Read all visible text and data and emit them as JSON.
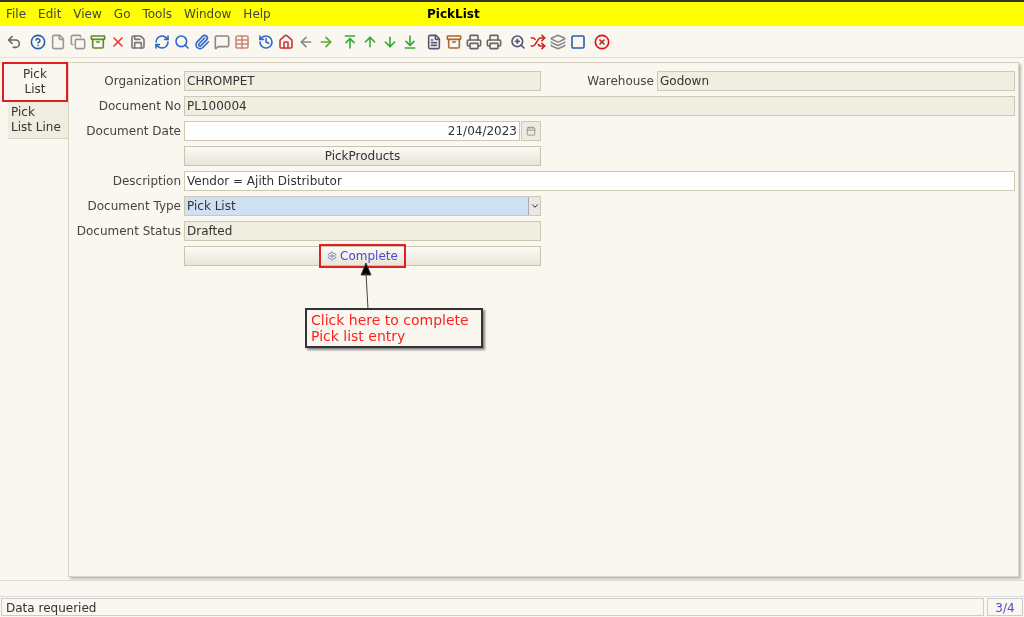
{
  "menu": [
    "File",
    "Edit",
    "View",
    "Go",
    "Tools",
    "Window",
    "Help"
  ],
  "window_title": "PickList",
  "tabs": [
    {
      "label": "Pick\nList",
      "selected": true,
      "annotated": true
    },
    {
      "label": "Pick\nList Line",
      "selected": false,
      "annotated": false
    }
  ],
  "rows": [
    [
      {
        "kind": "readonly",
        "label": "Organization",
        "value": "CHROMPET"
      },
      {
        "kind": "readonly",
        "label": "Warehouse",
        "value": "Godown"
      }
    ],
    [
      {
        "kind": "readonly",
        "label": "Document No",
        "value": "PL100004",
        "wide": true
      }
    ],
    [
      {
        "kind": "date",
        "label": "Document Date",
        "value": "21/04/2023"
      }
    ],
    [
      {
        "kind": "button",
        "label": "PickProducts",
        "annotated": false
      }
    ],
    [
      {
        "kind": "text",
        "label": "Description",
        "value": "Vendor = Ajith Distributor",
        "wide": true
      }
    ],
    [
      {
        "kind": "select",
        "label": "Document Type",
        "value": "Pick List"
      }
    ],
    [
      {
        "kind": "readonly",
        "label": "Document Status",
        "value": "Drafted"
      }
    ],
    [
      {
        "kind": "button",
        "label": "Complete",
        "annotated": true,
        "icon": true
      }
    ]
  ],
  "callout": {
    "lines": [
      "Click here to complete",
      "Pick list entry"
    ]
  },
  "status_bar": {
    "message": "Data requeried",
    "record": "3/4"
  }
}
